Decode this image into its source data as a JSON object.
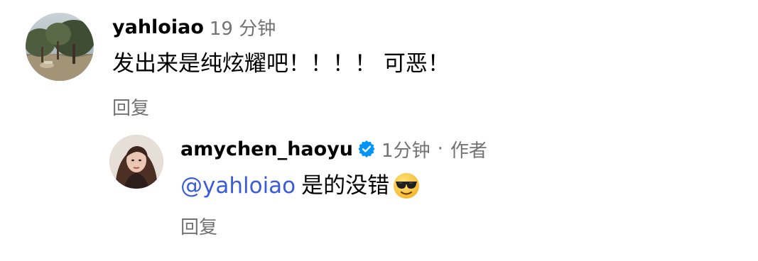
{
  "comments": [
    {
      "username": "yahloiao",
      "time": "19 分钟",
      "text": "发出来是纯炫耀吧！！！！ 可恶！",
      "reply_label": "回复"
    },
    {
      "username": "amychen_haoyu",
      "verified": true,
      "time": "1分钟",
      "separator": "·",
      "author_label": "作者",
      "mention": "@yahloiao",
      "text": "是的没错",
      "emoji": "smiling-face-with-sunglasses-icon",
      "reply_label": "回复"
    }
  ],
  "colors": {
    "secondary_text": "#737373",
    "mention": "#3b5bdb",
    "verified_badge": "#0095f6"
  }
}
